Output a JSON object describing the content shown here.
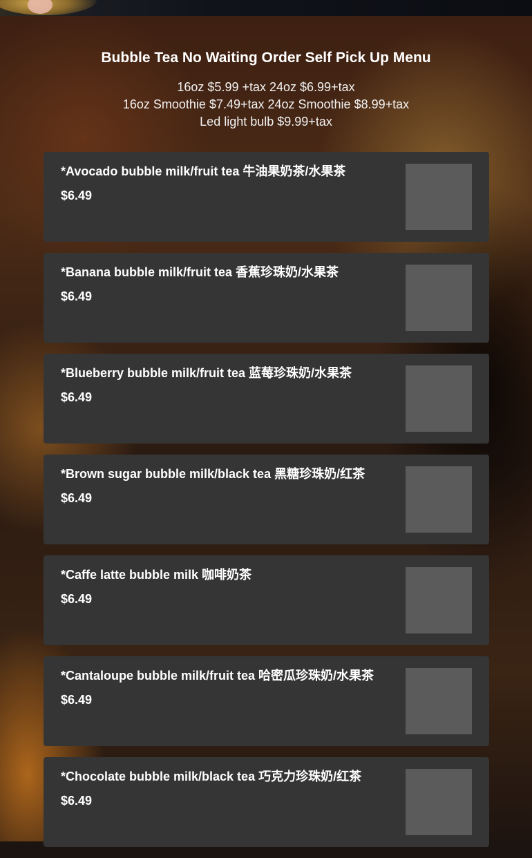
{
  "header": {
    "title": "Bubble Tea No Waiting Order Self Pick Up Menu",
    "subtitle_lines": [
      "16oz $5.99 +tax 24oz $6.99+tax",
      "16oz Smoothie $7.49+tax 24oz Smoothie $8.99+tax",
      "Led light bulb $9.99+tax"
    ]
  },
  "menu": {
    "items": [
      {
        "name": "*Avocado bubble milk/fruit tea 牛油果奶茶/水果茶",
        "price": "$6.49"
      },
      {
        "name": "*Banana bubble milk/fruit tea 香蕉珍珠奶/水果茶",
        "price": "$6.49"
      },
      {
        "name": "*Blueberry bubble milk/fruit tea 蓝莓珍珠奶/水果茶",
        "price": "$6.49"
      },
      {
        "name": "*Brown sugar bubble milk/black tea 黑糖珍珠奶/红茶",
        "price": "$6.49"
      },
      {
        "name": "*Caffe latte bubble milk 咖啡奶茶",
        "price": "$6.49"
      },
      {
        "name": "*Cantaloupe bubble milk/fruit tea 哈密瓜珍珠奶/水果茶",
        "price": "$6.49"
      },
      {
        "name": "*Chocolate bubble milk/black tea 巧克力珍珠奶/红茶",
        "price": "$6.49"
      }
    ]
  }
}
